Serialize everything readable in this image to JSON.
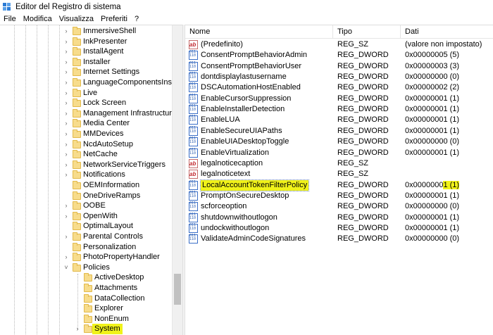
{
  "window": {
    "title": "Editor del Registro di sistema",
    "icon": "registry-editor-icon"
  },
  "menu": [
    "File",
    "Modifica",
    "Visualizza",
    "Preferiti",
    "?"
  ],
  "tree": {
    "items": [
      {
        "label": "ImmersiveShell",
        "expander": "›"
      },
      {
        "label": "InkPresenter",
        "expander": "›"
      },
      {
        "label": "InstallAgent",
        "expander": "›"
      },
      {
        "label": "Installer",
        "expander": "›"
      },
      {
        "label": "Internet Settings",
        "expander": "›"
      },
      {
        "label": "LanguageComponentsInstaller",
        "expander": "›"
      },
      {
        "label": "Live",
        "expander": "›"
      },
      {
        "label": "Lock Screen",
        "expander": "›"
      },
      {
        "label": "Management Infrastructure",
        "expander": "›"
      },
      {
        "label": "Media Center",
        "expander": "›"
      },
      {
        "label": "MMDevices",
        "expander": "›"
      },
      {
        "label": "NcdAutoSetup",
        "expander": "›"
      },
      {
        "label": "NetCache",
        "expander": "›"
      },
      {
        "label": "NetworkServiceTriggers",
        "expander": "›"
      },
      {
        "label": "Notifications",
        "expander": "›"
      },
      {
        "label": "OEMInformation",
        "expander": ""
      },
      {
        "label": "OneDriveRamps",
        "expander": ""
      },
      {
        "label": "OOBE",
        "expander": "›"
      },
      {
        "label": "OpenWith",
        "expander": "›"
      },
      {
        "label": "OptimalLayout",
        "expander": ""
      },
      {
        "label": "Parental Controls",
        "expander": "›"
      },
      {
        "label": "Personalization",
        "expander": ""
      },
      {
        "label": "PhotoPropertyHandler",
        "expander": "›"
      },
      {
        "label": "Policies",
        "expander": "˅"
      },
      {
        "label": "ActiveDesktop",
        "expander": ""
      },
      {
        "label": "Attachments",
        "expander": ""
      },
      {
        "label": "DataCollection",
        "expander": ""
      },
      {
        "label": "Explorer",
        "expander": ""
      },
      {
        "label": "NonEnum",
        "expander": ""
      },
      {
        "label": "System",
        "expander": "›",
        "highlighted": true
      }
    ]
  },
  "list": {
    "columns": [
      "Nome",
      "Tipo",
      "Dati"
    ],
    "rows": [
      {
        "icon": "string-value-icon",
        "kind": "sz",
        "name": "(Predefinito)",
        "type": "REG_SZ",
        "data": "(valore non impostato)"
      },
      {
        "icon": "dword-value-icon",
        "kind": "dw",
        "name": "ConsentPromptBehaviorAdmin",
        "type": "REG_DWORD",
        "data": "0x00000005 (5)"
      },
      {
        "icon": "dword-value-icon",
        "kind": "dw",
        "name": "ConsentPromptBehaviorUser",
        "type": "REG_DWORD",
        "data": "0x00000003 (3)"
      },
      {
        "icon": "dword-value-icon",
        "kind": "dw",
        "name": "dontdisplaylastusername",
        "type": "REG_DWORD",
        "data": "0x00000000 (0)"
      },
      {
        "icon": "dword-value-icon",
        "kind": "dw",
        "name": "DSCAutomationHostEnabled",
        "type": "REG_DWORD",
        "data": "0x00000002 (2)"
      },
      {
        "icon": "dword-value-icon",
        "kind": "dw",
        "name": "EnableCursorSuppression",
        "type": "REG_DWORD",
        "data": "0x00000001 (1)"
      },
      {
        "icon": "dword-value-icon",
        "kind": "dw",
        "name": "EnableInstallerDetection",
        "type": "REG_DWORD",
        "data": "0x00000001 (1)"
      },
      {
        "icon": "dword-value-icon",
        "kind": "dw",
        "name": "EnableLUA",
        "type": "REG_DWORD",
        "data": "0x00000001 (1)"
      },
      {
        "icon": "dword-value-icon",
        "kind": "dw",
        "name": "EnableSecureUIAPaths",
        "type": "REG_DWORD",
        "data": "0x00000001 (1)"
      },
      {
        "icon": "dword-value-icon",
        "kind": "dw",
        "name": "EnableUIADesktopToggle",
        "type": "REG_DWORD",
        "data": "0x00000000 (0)"
      },
      {
        "icon": "dword-value-icon",
        "kind": "dw",
        "name": "EnableVirtualization",
        "type": "REG_DWORD",
        "data": "0x00000001 (1)"
      },
      {
        "icon": "string-value-icon",
        "kind": "sz",
        "name": "legalnoticecaption",
        "type": "REG_SZ",
        "data": ""
      },
      {
        "icon": "string-value-icon",
        "kind": "sz",
        "name": "legalnoticetext",
        "type": "REG_SZ",
        "data": ""
      },
      {
        "icon": "dword-value-icon",
        "kind": "dw",
        "name": "LocalAccountTokenFilterPolicy",
        "type": "REG_DWORD",
        "data": "0x00000001 (1)",
        "selected": true
      },
      {
        "icon": "dword-value-icon",
        "kind": "dw",
        "name": "PromptOnSecureDesktop",
        "type": "REG_DWORD",
        "data": "0x00000001 (1)"
      },
      {
        "icon": "dword-value-icon",
        "kind": "dw",
        "name": "scforceoption",
        "type": "REG_DWORD",
        "data": "0x00000000 (0)"
      },
      {
        "icon": "dword-value-icon",
        "kind": "dw",
        "name": "shutdownwithoutlogon",
        "type": "REG_DWORD",
        "data": "0x00000001 (1)"
      },
      {
        "icon": "dword-value-icon",
        "kind": "dw",
        "name": "undockwithoutlogon",
        "type": "REG_DWORD",
        "data": "0x00000001 (1)"
      },
      {
        "icon": "dword-value-icon",
        "kind": "dw",
        "name": "ValidateAdminCodeSignatures",
        "type": "REG_DWORD",
        "data": "0x00000000 (0)"
      }
    ]
  }
}
